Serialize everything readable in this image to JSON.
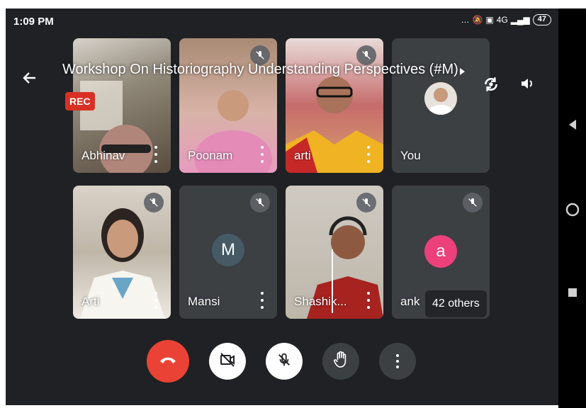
{
  "status_bar": {
    "time": "1:09 PM",
    "signal": "4G",
    "battery": "47"
  },
  "meeting": {
    "title": "Workshop On Historiography Understanding Perspectives (#M)",
    "recording_badge": "REC"
  },
  "participants": [
    {
      "name": "Abhinav",
      "muted": false
    },
    {
      "name": "Poonam",
      "muted": true
    },
    {
      "name": "arti",
      "muted": true
    },
    {
      "name": "You",
      "muted": true
    },
    {
      "name": "Arti",
      "muted": true
    },
    {
      "name": "Mansi",
      "muted": true,
      "avatar_letter": "M"
    },
    {
      "name": "Shashik...",
      "muted": true
    },
    {
      "name": "ank",
      "muted": true,
      "avatar_letter": "a"
    }
  ],
  "others_label": "42 others",
  "colors": {
    "background": "#202124",
    "tile": "#3c4043",
    "end_call": "#ea4335",
    "rec": "#d93025",
    "avatar_m": "#455a64",
    "avatar_a": "#ec407a"
  },
  "controls": [
    "end-call",
    "camera-off",
    "mic-off",
    "raise-hand",
    "more-options"
  ]
}
